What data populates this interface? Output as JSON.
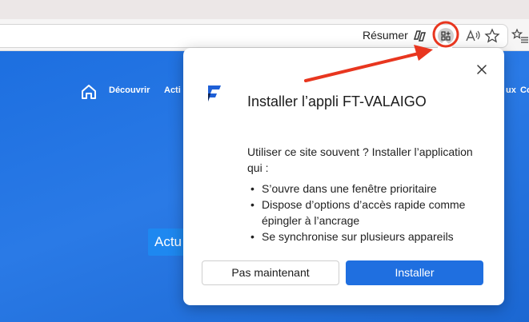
{
  "toolbar": {
    "summarize_label": "Résumer",
    "icons": [
      "summarize-icon",
      "app-install-icon",
      "read-aloud-icon",
      "favorite-star-icon",
      "favorites-list-icon"
    ]
  },
  "site_nav": {
    "items": [
      "Découvrir",
      "Acti",
      "ux",
      "Co"
    ],
    "partial_button_label": "Actu"
  },
  "popup": {
    "title": "Installer l’appli FT-VALAIGO",
    "description": "Utiliser ce site souvent ? Installer l’application qui :",
    "features": [
      "S’ouvre dans une fenêtre prioritaire",
      "Dispose d’options d’accès rapide comme épingler à l’ancrage",
      "Se synchronise sur plusieurs appareils"
    ],
    "secondary_button": "Pas maintenant",
    "primary_button": "Installer"
  },
  "colors": {
    "page_background": "#1f6fd8",
    "primary_button": "#1f6fe0",
    "annotation": "#e8361f",
    "logo_blue": "#1e5fd6",
    "logo_dark": "#0c1f4a"
  }
}
